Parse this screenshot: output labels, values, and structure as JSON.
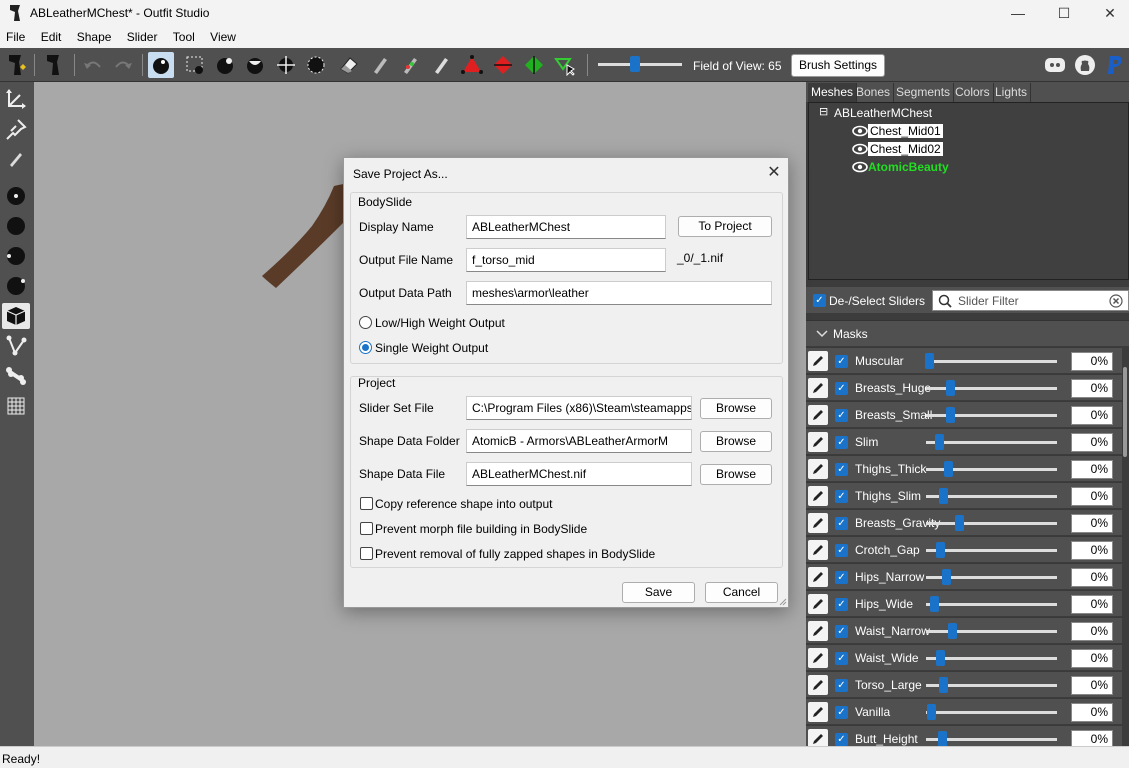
{
  "window": {
    "title": "ABLeatherMChest* - Outfit Studio",
    "minimize": "—",
    "maximize": "☐",
    "close": "✕"
  },
  "menu": [
    "File",
    "Edit",
    "Shape",
    "Slider",
    "Tool",
    "View"
  ],
  "toolbar": {
    "fov_label": "Field of View: 65",
    "fov_value": 65,
    "brush_settings": "Brush Settings"
  },
  "tabs": [
    "Meshes",
    "Bones",
    "Segments",
    "Colors",
    "Lights"
  ],
  "tree": {
    "root": "ABLeatherMChest",
    "items": [
      {
        "label": "Chest_Mid01",
        "color": "#000000"
      },
      {
        "label": "Chest_Mid02",
        "color": "#000000"
      },
      {
        "label": "AtomicBeauty",
        "color": "#22dd22"
      }
    ]
  },
  "slider_panel": {
    "select_label": "De-/Select Sliders",
    "filter_placeholder": "Slider Filter",
    "masks_label": "Masks",
    "sliders": [
      {
        "name": "Muscular",
        "value": "0%",
        "pos": 0.02
      },
      {
        "name": "Breasts_Huge",
        "value": "0%",
        "pos": 0.18
      },
      {
        "name": "Breasts_Small",
        "value": "0%",
        "pos": 0.18
      },
      {
        "name": "Slim",
        "value": "0%",
        "pos": 0.1
      },
      {
        "name": "Thighs_Thick",
        "value": "0%",
        "pos": 0.17
      },
      {
        "name": "Thighs_Slim",
        "value": "0%",
        "pos": 0.13
      },
      {
        "name": "Breasts_Gravity",
        "value": "0%",
        "pos": 0.25
      },
      {
        "name": "Crotch_Gap",
        "value": "0%",
        "pos": 0.11
      },
      {
        "name": "Hips_Narrow",
        "value": "0%",
        "pos": 0.15
      },
      {
        "name": "Hips_Wide",
        "value": "0%",
        "pos": 0.06
      },
      {
        "name": "Waist_Narrow",
        "value": "0%",
        "pos": 0.2
      },
      {
        "name": "Waist_Wide",
        "value": "0%",
        "pos": 0.11
      },
      {
        "name": "Torso_Large",
        "value": "0%",
        "pos": 0.13
      },
      {
        "name": "Vanilla",
        "value": "0%",
        "pos": 0.04
      },
      {
        "name": "Butt_Height",
        "value": "0%",
        "pos": 0.12
      }
    ]
  },
  "status": "Ready!",
  "dialog": {
    "title": "Save Project As...",
    "bodyslide_group": "BodySlide",
    "display_name_label": "Display Name",
    "display_name_value": "ABLeatherMChest",
    "to_project": "To Project",
    "output_file_label": "Output File Name",
    "output_file_value": "f_torso_mid",
    "output_suffix": "_0/_1.nif",
    "output_path_label": "Output Data Path",
    "output_path_value": "meshes\\armor\\leather",
    "low_high": "Low/High Weight Output",
    "single": "Single Weight Output",
    "project_group": "Project",
    "slider_set_label": "Slider Set File",
    "slider_set_value": "C:\\Program Files (x86)\\Steam\\steamapps\\",
    "shape_folder_label": "Shape Data Folder",
    "shape_folder_value": "AtomicB - Armors\\ABLeatherArmorM",
    "shape_file_label": "Shape Data File",
    "shape_file_value": "ABLeatherMChest.nif",
    "browse": "Browse",
    "copy_ref": "Copy reference shape into output",
    "prevent_morph": "Prevent morph file building in BodySlide",
    "prevent_removal": "Prevent removal of fully zapped shapes in BodySlide",
    "save": "Save",
    "cancel": "Cancel"
  }
}
